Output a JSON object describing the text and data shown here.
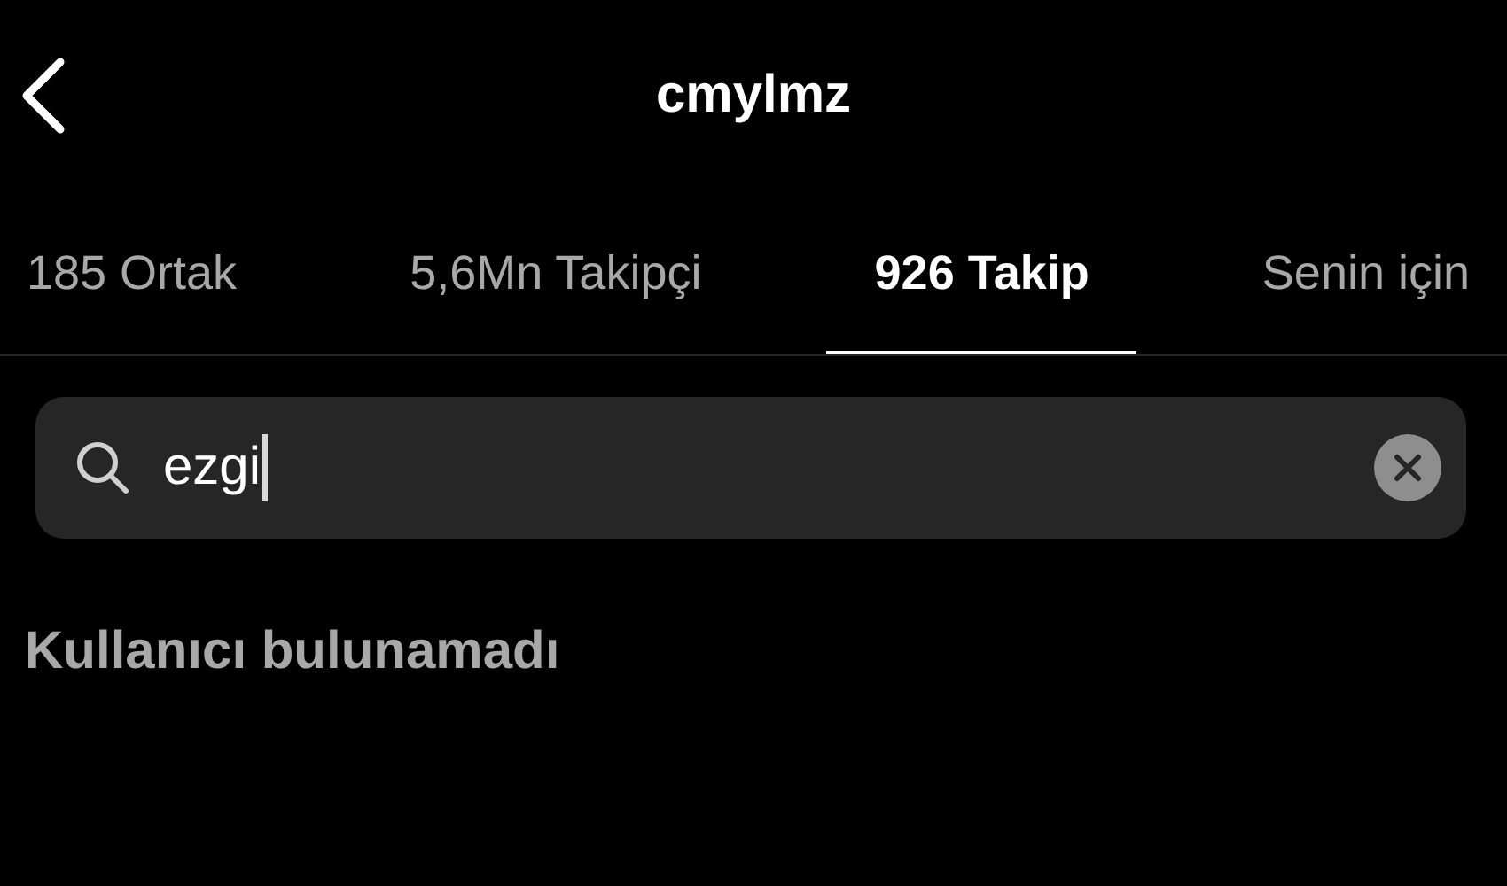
{
  "header": {
    "title": "cmylmz"
  },
  "tabs": [
    {
      "label": "185 Ortak",
      "selected": false
    },
    {
      "label": "5,6Mn Takipçi",
      "selected": false
    },
    {
      "label": "926 Takip",
      "selected": true
    },
    {
      "label": "Senin için",
      "selected": false
    }
  ],
  "search": {
    "value": "ezgi",
    "focused": true
  },
  "empty_message": "Kullanıcı bulunamadı"
}
